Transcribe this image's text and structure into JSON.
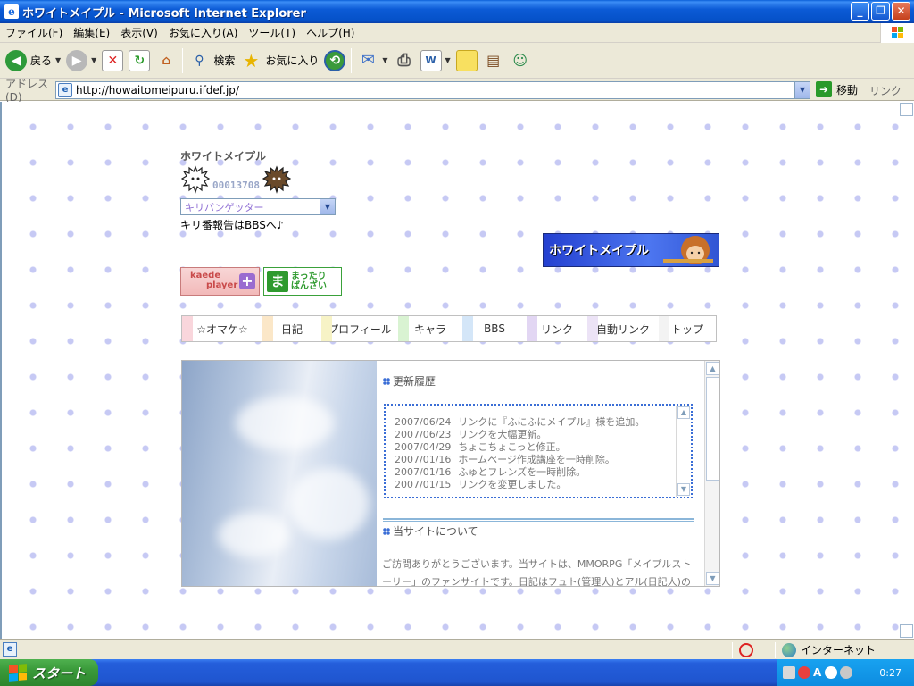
{
  "window": {
    "title": "ホワイトメイプル - Microsoft Internet Explorer"
  },
  "menu": [
    "ファイル(F)",
    "編集(E)",
    "表示(V)",
    "お気に入り(A)",
    "ツール(T)",
    "ヘルプ(H)"
  ],
  "toolbar": {
    "back_label": "戻る",
    "search_label": "検索",
    "favorites_label": "お気に入り"
  },
  "address": {
    "label": "アドレス(D)",
    "url": "http://howaitomeipuru.ifdef.jp/",
    "go_label": "移動",
    "links_label": "リンク"
  },
  "page": {
    "site_title": "ホワイトメイプル",
    "counter_digits": "00013708",
    "kiriban_select_value": "キリバンゲッター",
    "kiriban_note": "キリ番報告はBBSへ♪",
    "banner_text": "ホワイトメイプル",
    "kaede_line1": "kaede",
    "kaede_line2": "player",
    "mattari_char": "ま",
    "mattari_line1": "まったり",
    "mattari_line2": "ばんざい",
    "nav": [
      "☆オマケ☆",
      "日記",
      "プロフィール",
      "キャラ",
      "BBS",
      "リンク",
      "自動リンク",
      "トップ"
    ],
    "history_heading": "更新履歴",
    "history": [
      {
        "date": "2007/06/24",
        "text": "リンクに『ふにふにメイプル』様を追加。"
      },
      {
        "date": "2007/06/23",
        "text": "リンクを大幅更新。"
      },
      {
        "date": "2007/04/29",
        "text": "ちょこちょこっと修正。"
      },
      {
        "date": "2007/01/16",
        "text": "ホームページ作成講座を一時削除。"
      },
      {
        "date": "2007/01/16",
        "text": "ふゅとフレンズを一時削除。"
      },
      {
        "date": "2007/01/15",
        "text": "リンクを変更しました。"
      }
    ],
    "about_heading": "当サイトについて",
    "about_text": "ご訪問ありがとうございます。当サイトは、MMORPG「メイプルストーリー」のファンサイトです。日記はフュト(管理人)とアル(日記人)の二人"
  },
  "status": {
    "zone": "インターネット"
  },
  "taskbar": {
    "start_label": "スタート",
    "ime": "A",
    "clock": "0:27"
  },
  "colors": {
    "titlebar": "#0c5bd6",
    "chrome": "#ece9d8",
    "polka_dot": "#c6c9f4",
    "accent_blue": "#3b6ed6"
  }
}
